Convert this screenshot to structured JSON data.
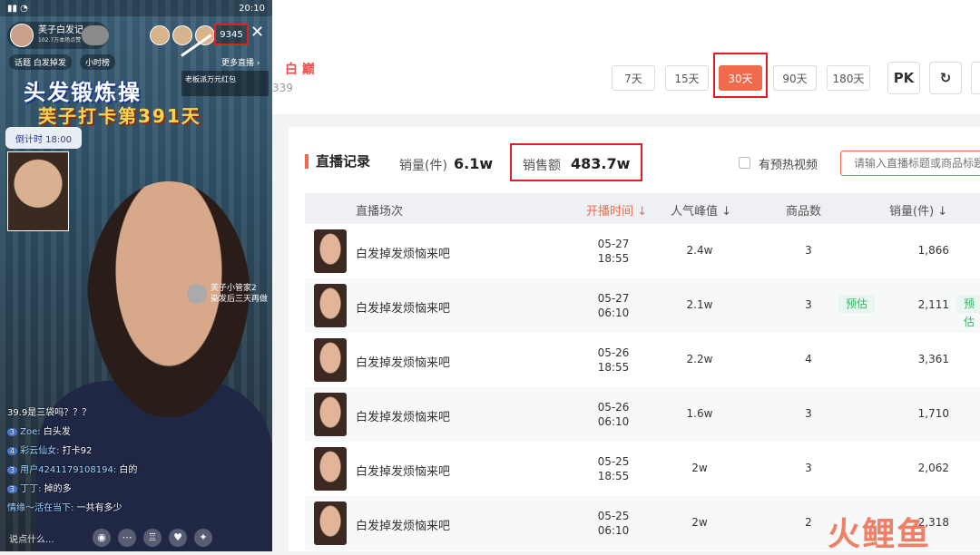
{
  "phone": {
    "status_time": "20:10",
    "host_name": "芙子白发记",
    "host_sub": "102.7万本场点赞",
    "viewer_count": "9345",
    "topic": "话题 白发掉发",
    "hour_rank": "小时榜",
    "more_live": "更多直播 ›",
    "promo": "老板派万元红包",
    "banner_title": "头发锻炼操",
    "banner_sub": "芙子打卡第391天",
    "timer": "倒计时 18:00",
    "manager_name": "芙子小管家2",
    "manager_msg": "染发后三天再做",
    "chat": [
      {
        "level": "",
        "user": "",
        "text": "39.9是三袋吗？？？"
      },
      {
        "level": "3",
        "user": "Zoe:",
        "text": "白头发"
      },
      {
        "level": "4",
        "user": "彩云仙女:",
        "text": "打卡92"
      },
      {
        "level": "3",
        "user": "用户4241179108194:",
        "text": "白的"
      },
      {
        "level": "3",
        "user": "丁丁:",
        "text": "掉的多"
      },
      {
        "level": "",
        "user": "情缘～活在当下:",
        "text": "一共有多少"
      }
    ],
    "say_placeholder": "说点什么...",
    "icons": [
      "mic-icon",
      "more-icon",
      "cart-icon",
      "gift-icon"
    ]
  },
  "header": {
    "brand": "白 巅",
    "account_num": "339",
    "ranges": [
      "7天",
      "15天",
      "30天",
      "90天",
      "180天"
    ],
    "active_range": "30天",
    "pk_label": "PK",
    "refresh_icon": "↻"
  },
  "records": {
    "title": "直播记录",
    "sales_count_label": "销量(件)",
    "sales_count_value": "6.1w",
    "sales_amount_label": "销售额",
    "sales_amount_value": "483.7w",
    "preheat_label": "有预热视频",
    "search_placeholder": "请输入直播标题或商品标题",
    "columns": {
      "session": "直播场次",
      "start": "开播时间 ↓",
      "peak": "人气峰值 ↓",
      "goods": "商品数",
      "sales": "销量(件) ↓"
    },
    "estimate_tag": "预估",
    "rows": [
      {
        "title": "白发掉发烦恼来吧",
        "date": "05-27",
        "time": "18:55",
        "peak": "2.4w",
        "goods": "3",
        "sales": "1,866"
      },
      {
        "title": "白发掉发烦恼来吧",
        "date": "05-27",
        "time": "06:10",
        "peak": "2.1w",
        "goods": "3",
        "sales": "2,111"
      },
      {
        "title": "白发掉发烦恼来吧",
        "date": "05-26",
        "time": "18:55",
        "peak": "2.2w",
        "goods": "4",
        "sales": "3,361"
      },
      {
        "title": "白发掉发烦恼来吧",
        "date": "05-26",
        "time": "06:10",
        "peak": "1.6w",
        "goods": "3",
        "sales": "1,710"
      },
      {
        "title": "白发掉发烦恼来吧",
        "date": "05-25",
        "time": "18:55",
        "peak": "2w",
        "goods": "3",
        "sales": "2,062"
      },
      {
        "title": "白发掉发烦恼来吧",
        "date": "05-25",
        "time": "06:10",
        "peak": "2w",
        "goods": "2",
        "sales": "2,318"
      }
    ]
  },
  "watermark": "火鲤鱼",
  "colors": {
    "accent": "#f06a4c",
    "highlight": "#e02020",
    "tag_green": "#39b36a"
  }
}
